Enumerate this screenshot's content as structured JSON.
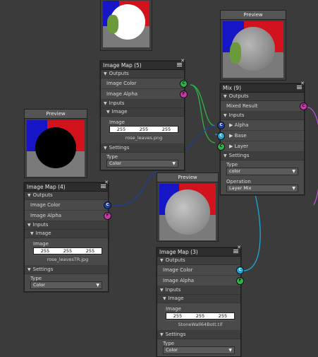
{
  "colors": {
    "background": "#3b3b3b",
    "wire_green": "#2fb34a",
    "wire_cyan": "#1fa6d6",
    "wire_blue": "#1e3f9e",
    "wire_magenta": "#b24fd6"
  },
  "previews": {
    "p1": {
      "title": ""
    },
    "p2": {
      "title": "Preview"
    },
    "p3": {
      "title": "Preview"
    },
    "p4": {
      "title": "Preview"
    }
  },
  "node_5": {
    "title": "Image Map (5)",
    "outputs_label": "Outputs",
    "out_color": "Image Color",
    "out_color_socket": "C",
    "out_alpha": "Image Alpha",
    "out_alpha_socket": "F",
    "inputs_label": "Inputs",
    "image_section": "Image",
    "image_label": "Image",
    "rgb": [
      "255",
      "255",
      "255"
    ],
    "file": "rose_leaves.png",
    "settings_label": "Settings",
    "type_label": "Type",
    "type_value": "Color"
  },
  "node_4": {
    "title": "Image Map (4)",
    "outputs_label": "Outputs",
    "out_color": "Image Color",
    "out_color_socket": "C",
    "out_alpha": "Image Alpha",
    "out_alpha_socket": "F",
    "inputs_label": "Inputs",
    "image_section": "Image",
    "image_label": "Image",
    "rgb": [
      "255",
      "255",
      "255"
    ],
    "file": "rose_leavesTR.jpg",
    "settings_label": "Settings",
    "type_label": "Type",
    "type_value": "Color"
  },
  "node_3": {
    "title": "Image Map (3)",
    "outputs_label": "Outputs",
    "out_color": "Image Color",
    "out_color_socket": "C",
    "out_alpha": "Image Alpha",
    "out_alpha_socket": "F",
    "inputs_label": "Inputs",
    "image_section": "Image",
    "image_label": "Image",
    "rgb": [
      "255",
      "255",
      "255"
    ],
    "file": "StoneWall64Bott.tif",
    "settings_label": "Settings",
    "type_label": "Type",
    "type_value": "Color"
  },
  "mix_9": {
    "title": "Mix (9)",
    "outputs_label": "Outputs",
    "mixed_result": "Mixed Result",
    "mixed_socket": "C",
    "inputs_label": "Inputs",
    "alpha": "Alpha",
    "alpha_socket": "C",
    "base": "Base",
    "base_socket": "C",
    "layer": "Layer",
    "layer_socket": "C",
    "settings_label": "Settings",
    "type_label": "Type",
    "type_value": "color",
    "operation_label": "Operation",
    "operation_value": "Layer Mix"
  }
}
